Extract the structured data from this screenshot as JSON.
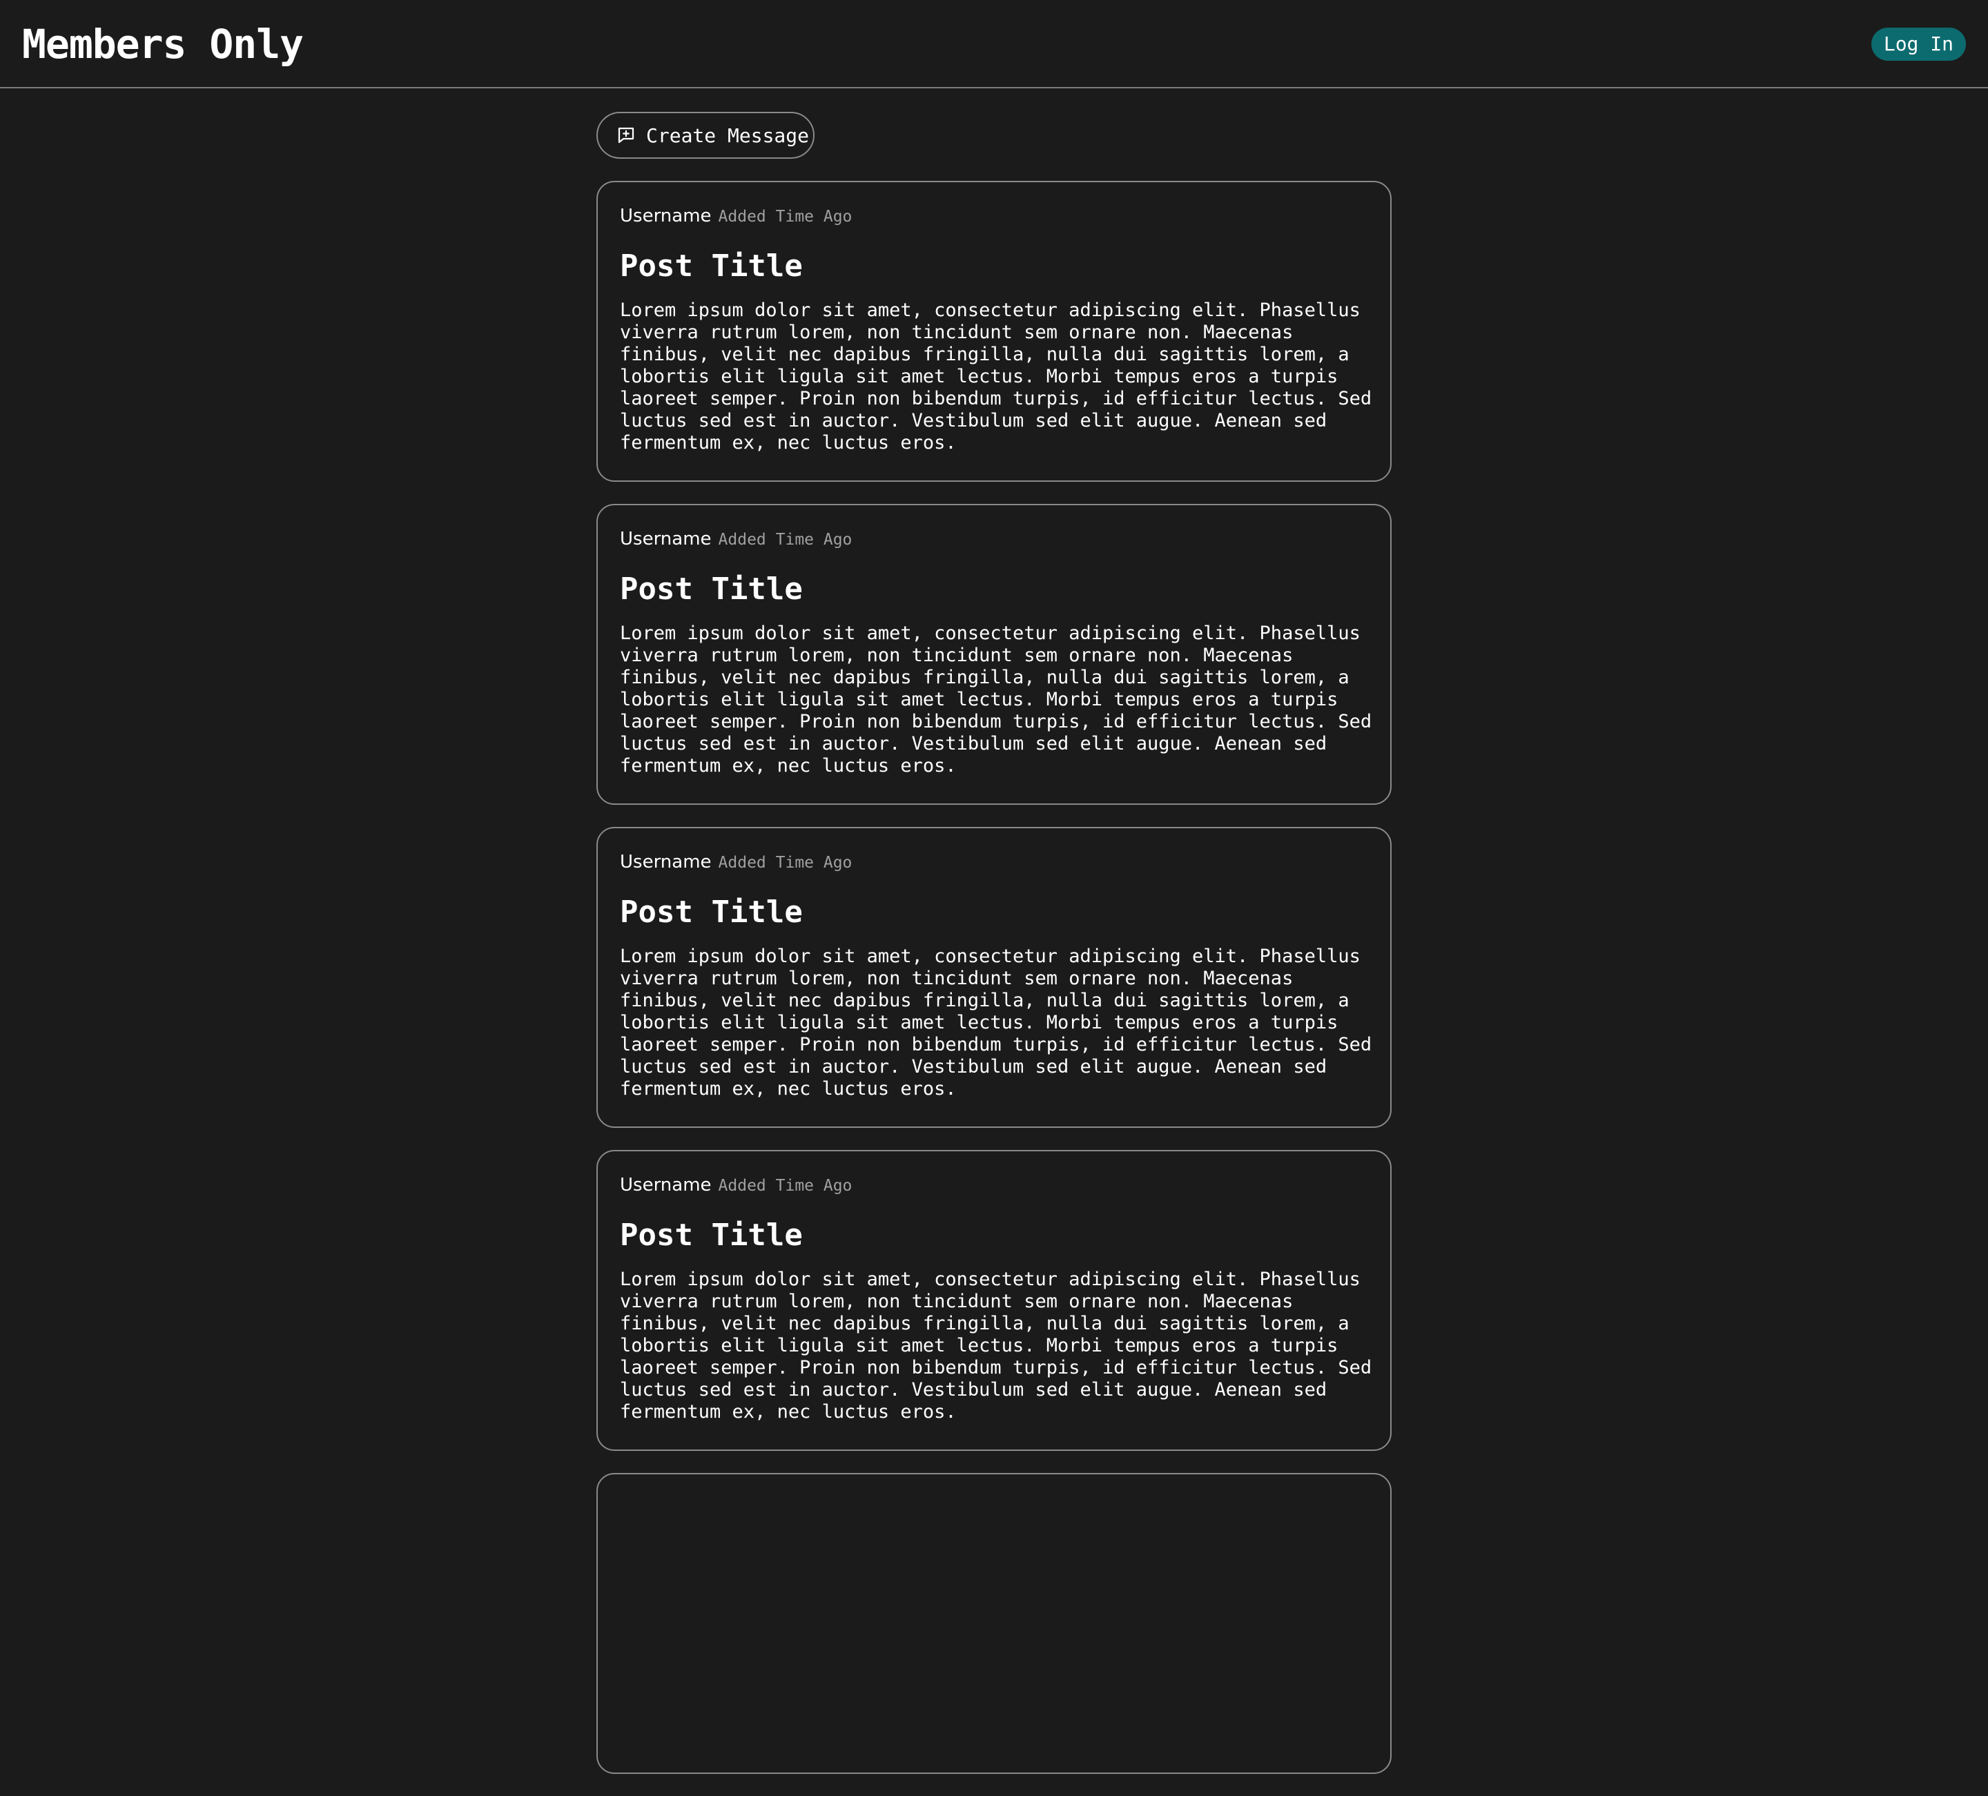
{
  "header": {
    "brand": "Members Only",
    "login_label": "Log In"
  },
  "actions": {
    "create_label": "Create Message"
  },
  "posts": [
    {
      "username": "Username",
      "time": "Added Time Ago",
      "title": "Post Title",
      "body": "Lorem ipsum dolor sit amet, consectetur adipiscing elit. Phasellus\nviverra rutrum lorem, non tincidunt sem ornare non. Maecenas\nfinibus, velit nec dapibus fringilla, nulla dui sagittis lorem, a\nlobortis elit ligula sit amet lectus. Morbi tempus eros a turpis\nlaoreet semper. Proin non bibendum turpis, id efficitur lectus. Sed\nluctus sed est in auctor. Vestibulum sed elit augue. Aenean sed\nfermentum ex, nec luctus eros."
    },
    {
      "username": "Username",
      "time": "Added Time Ago",
      "title": "Post Title",
      "body": "Lorem ipsum dolor sit amet, consectetur adipiscing elit. Phasellus\nviverra rutrum lorem, non tincidunt sem ornare non. Maecenas\nfinibus, velit nec dapibus fringilla, nulla dui sagittis lorem, a\nlobortis elit ligula sit amet lectus. Morbi tempus eros a turpis\nlaoreet semper. Proin non bibendum turpis, id efficitur lectus. Sed\nluctus sed est in auctor. Vestibulum sed elit augue. Aenean sed\nfermentum ex, nec luctus eros."
    },
    {
      "username": "Username",
      "time": "Added Time Ago",
      "title": "Post Title",
      "body": "Lorem ipsum dolor sit amet, consectetur adipiscing elit. Phasellus\nviverra rutrum lorem, non tincidunt sem ornare non. Maecenas\nfinibus, velit nec dapibus fringilla, nulla dui sagittis lorem, a\nlobortis elit ligula sit amet lectus. Morbi tempus eros a turpis\nlaoreet semper. Proin non bibendum turpis, id efficitur lectus. Sed\nluctus sed est in auctor. Vestibulum sed elit augue. Aenean sed\nfermentum ex, nec luctus eros."
    },
    {
      "username": "Username",
      "time": "Added Time Ago",
      "title": "Post Title",
      "body": "Lorem ipsum dolor sit amet, consectetur adipiscing elit. Phasellus\nviverra rutrum lorem, non tincidunt sem ornare non. Maecenas\nfinibus, velit nec dapibus fringilla, nulla dui sagittis lorem, a\nlobortis elit ligula sit amet lectus. Morbi tempus eros a turpis\nlaoreet semper. Proin non bibendum turpis, id efficitur lectus. Sed\nluctus sed est in auctor. Vestibulum sed elit augue. Aenean sed\nfermentum ex, nec luctus eros."
    },
    {
      "username": "",
      "time": "",
      "title": "",
      "body": ""
    }
  ],
  "colors": {
    "background": "#1b1b1b",
    "accent": "#0c6b6f",
    "border": "#8a8a8a",
    "muted_text": "#a0a0a0"
  },
  "icons": {
    "create": "message-plus-icon"
  }
}
